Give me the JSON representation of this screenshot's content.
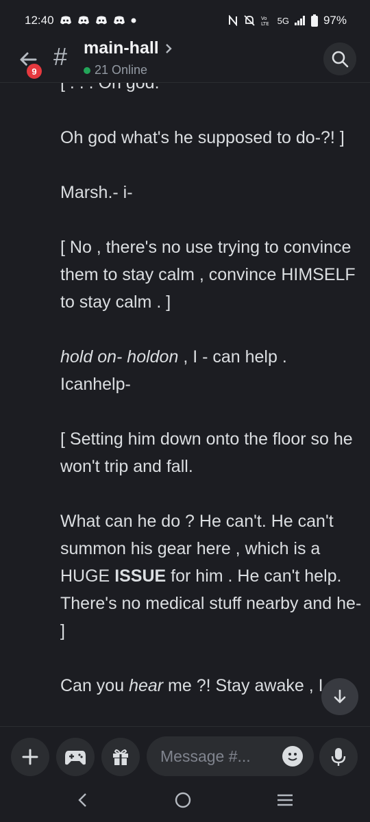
{
  "status_bar": {
    "time": "12:40",
    "battery": "97%",
    "network": "5G"
  },
  "header": {
    "channel_name": "main-hall",
    "online": "21 Online",
    "badge_count": "9"
  },
  "messages": [
    {
      "html": "[ . . . Oh god."
    },
    {
      "html": "Oh god what's he supposed to do-?! ]"
    },
    {
      "html": "Marsh.- i-"
    },
    {
      "html": "[ No , there's no use trying to convince them to stay calm , convince HIMSELF to stay calm . ]"
    },
    {
      "html": "<i>hold on- holdon</i> , I - can help . Icanhelp-"
    },
    {
      "html": "[ Setting him down onto the floor so he won't trip and fall."
    },
    {
      "html": "What can he do ? He can't. He can't summon his gear here , which is a HUGE <b>ISSUE</b> for him . He can't help. There's no medical stuff nearby and he- ]"
    },
    {
      "html": "Can you <i>hear</i> me ?! Stay awake , I"
    }
  ],
  "composer": {
    "placeholder": "Message #..."
  },
  "colors": {
    "background": "#1c1d22",
    "surface": "#2b2d31",
    "text": "#dbdee1",
    "online": "#23a559",
    "badge": "#e5393f"
  }
}
